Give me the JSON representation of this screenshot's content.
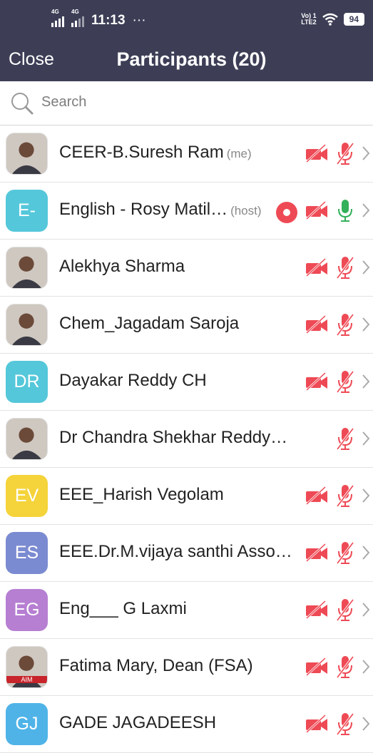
{
  "status": {
    "time": "11:13",
    "dots": "···",
    "net1": "4G",
    "net2": "4G",
    "volte": "Vo) 1",
    "lte": "LTE2",
    "battery": "94"
  },
  "header": {
    "close": "Close",
    "title": "Participants (20)"
  },
  "search": {
    "placeholder": "Search"
  },
  "colors": {
    "bar": "#3d3e56",
    "muted_icon": "#ee4a55",
    "unmuted_mic": "#33b05a"
  },
  "participants": [
    {
      "name": "CEER-B.Suresh Ram",
      "tag": "(me)",
      "avatar": "photo",
      "video_off": true,
      "mic": "muted",
      "recording": false
    },
    {
      "name": "English - Rosy Matil…",
      "tag": "(host)",
      "avatar": "E-",
      "color": "#55c7da",
      "video_off": true,
      "mic": "on",
      "recording": true
    },
    {
      "name": "Alekhya Sharma",
      "tag": "",
      "avatar": "photo",
      "video_off": true,
      "mic": "muted",
      "recording": false
    },
    {
      "name": "Chem_Jagadam Saroja",
      "tag": "",
      "avatar": "photo",
      "video_off": true,
      "mic": "muted",
      "recording": false
    },
    {
      "name": "Dayakar Reddy CH",
      "tag": "",
      "avatar": "DR",
      "color": "#55c7da",
      "video_off": true,
      "mic": "muted",
      "recording": false
    },
    {
      "name": "Dr Chandra Shekhar Reddy…",
      "tag": "",
      "avatar": "photo",
      "video_off": false,
      "mic": "muted",
      "recording": false
    },
    {
      "name": "EEE_Harish Vegolam",
      "tag": "",
      "avatar": "EV",
      "color": "#f5d33a",
      "video_off": true,
      "mic": "muted",
      "recording": false
    },
    {
      "name": "EEE.Dr.M.vijaya santhi Asso…",
      "tag": "",
      "avatar": "ES",
      "color": "#7b8bd1",
      "video_off": true,
      "mic": "muted",
      "recording": false
    },
    {
      "name": "Eng___ G Laxmi",
      "tag": "",
      "avatar": "EG",
      "color": "#b67fd2",
      "video_off": true,
      "mic": "muted",
      "recording": false
    },
    {
      "name": "Fatima Mary, Dean (FSA)",
      "tag": "",
      "avatar": "photo",
      "avatar_text": "AIM",
      "video_off": true,
      "mic": "muted",
      "recording": false
    },
    {
      "name": "GADE JAGADEESH",
      "tag": "",
      "avatar": "GJ",
      "color": "#4fb3e8",
      "video_off": true,
      "mic": "muted",
      "recording": false
    }
  ]
}
